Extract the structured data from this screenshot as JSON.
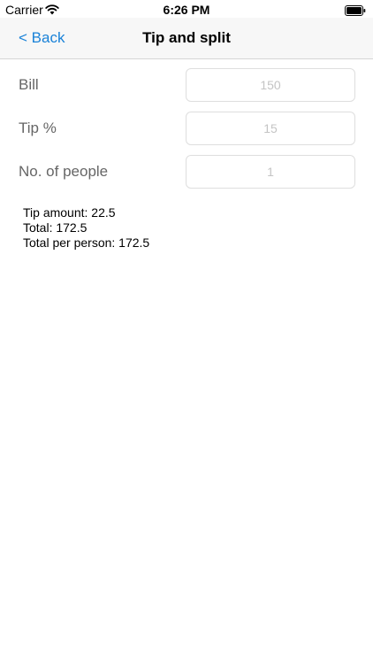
{
  "status_bar": {
    "carrier": "Carrier",
    "time": "6:26 PM",
    "wifi_icon": "wifi-icon",
    "battery_icon": "battery-icon"
  },
  "nav": {
    "back_label": "< Back",
    "title": "Tip and split"
  },
  "form": {
    "bill": {
      "label": "Bill",
      "placeholder": "150"
    },
    "tip": {
      "label": "Tip %",
      "placeholder": "15"
    },
    "people": {
      "label": "No. of people",
      "placeholder": "1"
    }
  },
  "results": {
    "tip_amount": "Tip amount: 22.5",
    "total": "Total: 172.5",
    "total_per_person": "Total per person: 172.5"
  },
  "colors": {
    "accent": "#1a82d8",
    "label_gray": "#666666",
    "placeholder_gray": "#c4c4c4",
    "nav_background": "#f7f7f7"
  }
}
